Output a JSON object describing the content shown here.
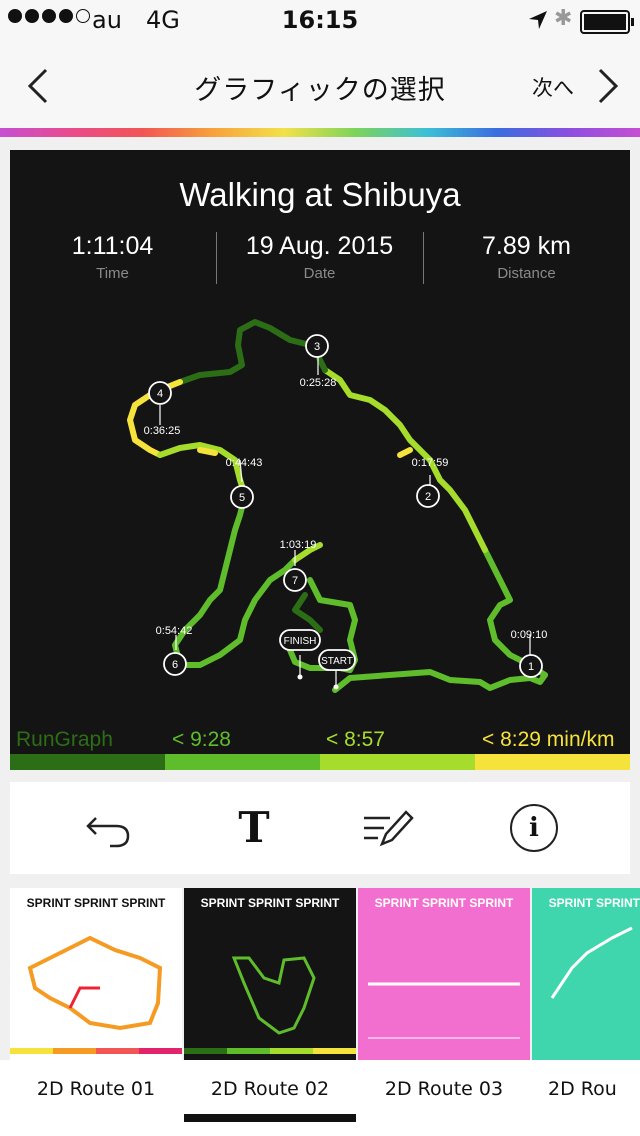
{
  "status_bar": {
    "carrier": "au",
    "network": "4G",
    "time": "16:15"
  },
  "nav": {
    "title": "グラフィックの選択",
    "next_label": "次へ"
  },
  "graphic": {
    "title": "Walking at Shibuya",
    "stats": [
      {
        "value": "1:11:04",
        "label": "Time"
      },
      {
        "value": "19 Aug. 2015",
        "label": "Date"
      },
      {
        "value": "7.89 km",
        "label": "Distance"
      }
    ],
    "checkpoints": [
      {
        "num": "1",
        "time": "0:09:10"
      },
      {
        "num": "2",
        "time": "0:17:59"
      },
      {
        "num": "3",
        "time": "0:25:28"
      },
      {
        "num": "4",
        "time": "0:36:25"
      },
      {
        "num": "5",
        "time": "0:44:43"
      },
      {
        "num": "6",
        "time": "0:54:42"
      },
      {
        "num": "7",
        "time": "1:03:19"
      }
    ],
    "finish_label": "FINISH",
    "start_label": "START",
    "legend": {
      "brand": "RunGraph",
      "pace1": "< 9:28",
      "pace2": "< 8:57",
      "pace3": "< 8:29 min/km"
    },
    "colors": {
      "dark_green": "#2c6e16",
      "green": "#5fbd2c",
      "light_green": "#a6dd2c",
      "yellow": "#f5e23a"
    }
  },
  "toolbar": {
    "items": [
      "undo-icon",
      "text-icon",
      "edit-icon",
      "info-icon"
    ],
    "text_glyph": "T",
    "info_glyph": "i"
  },
  "templates": [
    {
      "label": "2D Route 01",
      "thumb_title": "SPRINT SPRINT SPRINT",
      "selected": false
    },
    {
      "label": "2D Route 02",
      "thumb_title": "SPRINT SPRINT SPRINT",
      "selected": true
    },
    {
      "label": "2D Route 03",
      "thumb_title": "SPRINT SPRINT SPRINT",
      "selected": false
    },
    {
      "label": "2D Rou",
      "thumb_title": "SPRINT SPRINT SPRINT",
      "selected": false
    }
  ]
}
